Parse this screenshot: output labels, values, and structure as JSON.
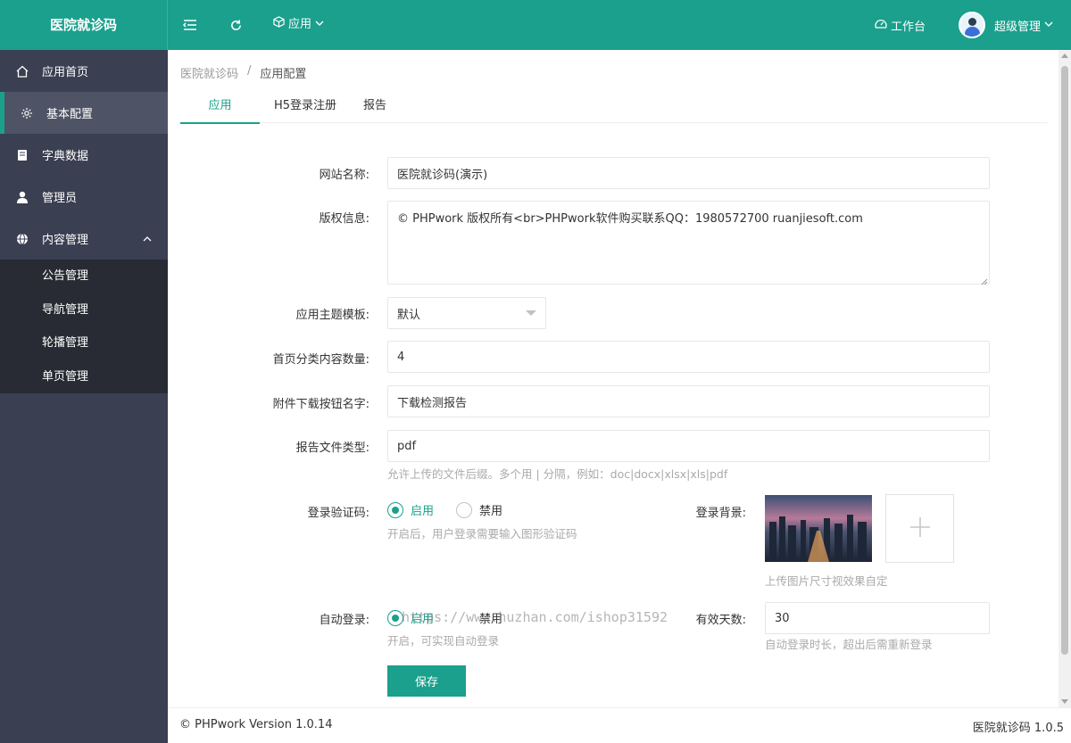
{
  "topbar": {
    "brand": "医院就诊码",
    "app_menu_label": "应用",
    "workbench_label": "工作台",
    "user_name": "超级管理",
    "bg_color": "#1aa08c"
  },
  "sidebar": {
    "items": [
      {
        "label": "应用首页",
        "icon": "home-icon"
      },
      {
        "label": "基本配置",
        "icon": "gear-icon"
      },
      {
        "label": "字典数据",
        "icon": "book-icon"
      },
      {
        "label": "管理员",
        "icon": "user-icon"
      },
      {
        "label": "内容管理",
        "icon": "globe-icon"
      }
    ],
    "sub_items": [
      {
        "label": "公告管理"
      },
      {
        "label": "导航管理"
      },
      {
        "label": "轮播管理"
      },
      {
        "label": "单页管理"
      }
    ]
  },
  "breadcrumb": {
    "root": "医院就诊码",
    "separator": "/",
    "current": "应用配置"
  },
  "tabs": [
    {
      "label": "应用",
      "active": true
    },
    {
      "label": "H5登录注册",
      "active": false
    },
    {
      "label": "报告",
      "active": false
    }
  ],
  "form": {
    "site_name_label": "网站名称:",
    "site_name_value": "医院就诊码(演示)",
    "copyright_label": "版权信息:",
    "copyright_value": "© PHPwork 版权所有<br>PHPwork软件购买联系QQ：1980572700 ruanjiesoft.com",
    "theme_label": "应用主题模板:",
    "theme_value": "默认",
    "home_count_label": "首页分类内容数量:",
    "home_count_value": "4",
    "download_btn_label": "附件下载按钮名字:",
    "download_btn_value": "下载检测报告",
    "report_type_label": "报告文件类型:",
    "report_type_value": "pdf",
    "report_type_hint": "允许上传的文件后缀。多个用 | 分隔，例如：doc|docx|xlsx|xls|pdf",
    "captcha_label": "登录验证码:",
    "captcha_on": "启用",
    "captcha_off": "禁用",
    "captcha_hint": "开启后，用户登录需要输入图形验证码",
    "login_bg_label": "登录背景:",
    "login_bg_hint": "上传图片尺寸视效果自定",
    "auto_login_label": "自动登录:",
    "auto_login_on": "启用",
    "auto_login_off": "禁用",
    "auto_login_hint": "开启，可实现自动登录",
    "valid_days_label": "有效天数:",
    "valid_days_value": "30",
    "valid_days_hint": "自动登录时长，超出后需重新登录",
    "save_label": "保存"
  },
  "watermark": "https://www.huzhan.com/ishop31592",
  "footer": {
    "left": "© PHPwork Version 1.0.14",
    "right": "医院就诊码 1.0.5"
  },
  "accent_color": "#1aa08c",
  "sidebar_color": "#3a3f51"
}
